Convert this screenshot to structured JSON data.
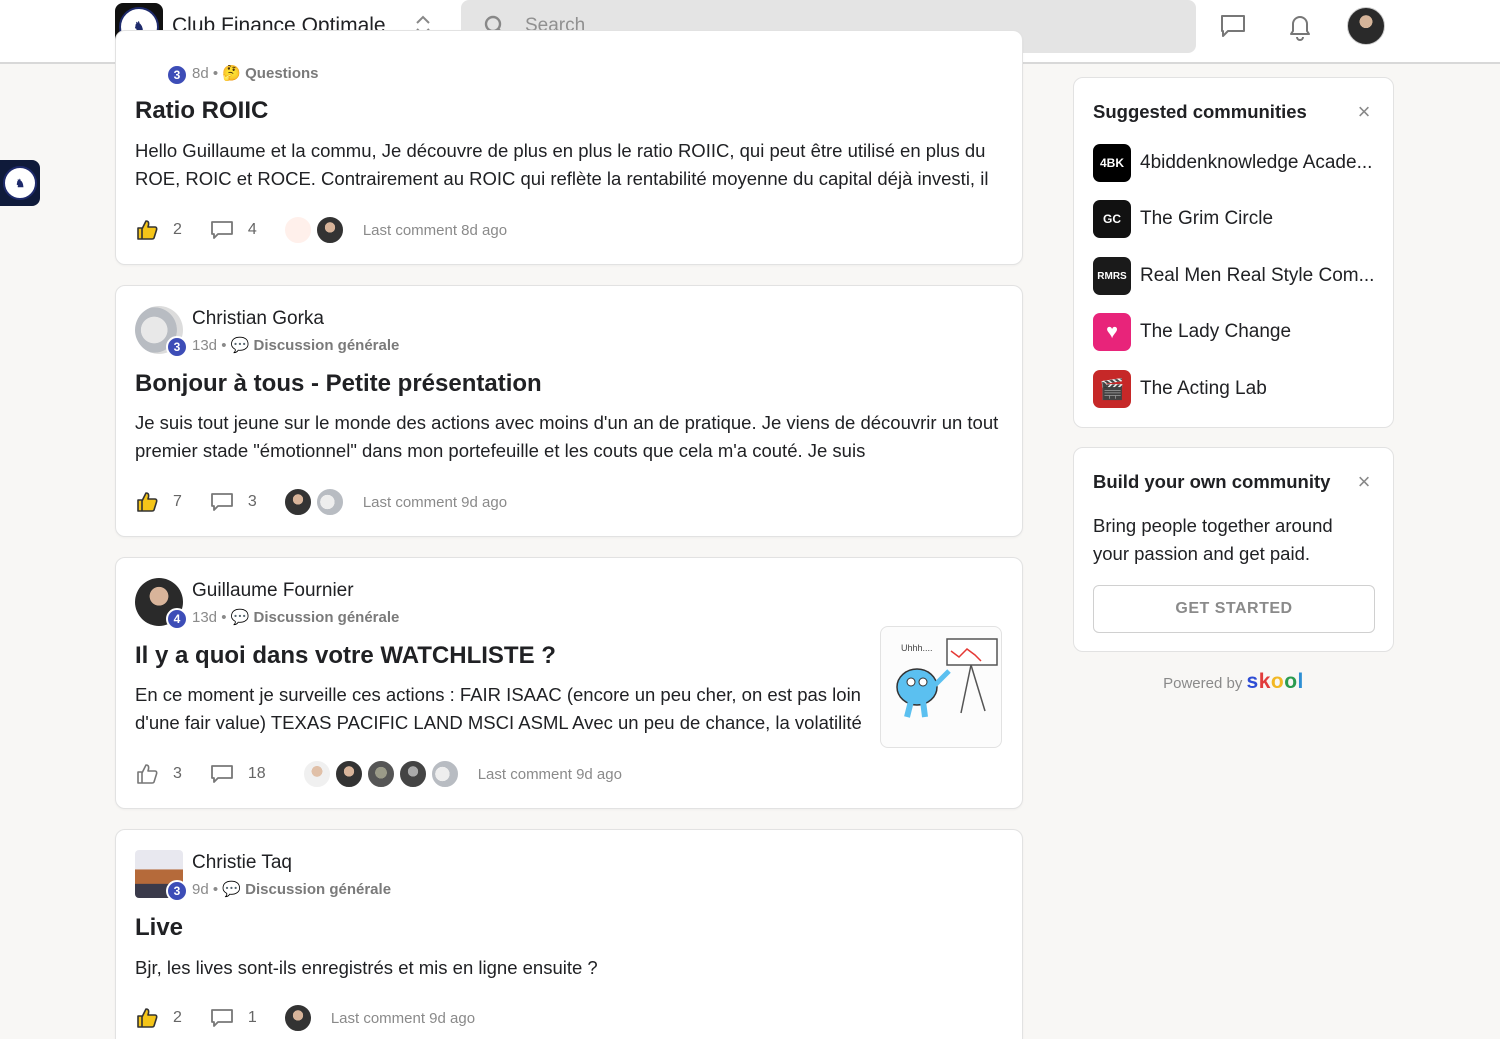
{
  "header": {
    "club_name": "Club Finance Optimale",
    "search_placeholder": "Search"
  },
  "posts": [
    {
      "level": "3",
      "time": "8d",
      "category_emoji": "🤔",
      "category": "Questions",
      "title": "Ratio ROIIC",
      "body": "Hello Guillaume et la commu, Je découvre de plus en plus le ratio ROIIC, qui peut être utilisé en plus du ROE, ROIC et ROCE. Contrairement au ROIC qui reflète la rentabilité moyenne du capital déjà investi, il",
      "likes": "2",
      "comments": "4",
      "last_comment": "Last comment 8d ago"
    },
    {
      "author": "Christian Gorka",
      "level": "3",
      "time": "13d",
      "category_emoji": "💬",
      "category": "Discussion générale",
      "title": "Bonjour à tous - Petite présentation",
      "body": "Je suis tout jeune sur le monde des actions avec moins d'un an de pratique. Je viens de découvrir un tout premier stade \"émotionnel\" dans mon portefeuille et les couts que cela m'a couté. Je suis",
      "likes": "7",
      "comments": "3",
      "last_comment": "Last comment 9d ago"
    },
    {
      "author": "Guillaume Fournier",
      "level": "4",
      "time": "13d",
      "category_emoji": "💬",
      "category": "Discussion générale",
      "title": "Il y a quoi dans votre WATCHLISTE ?",
      "body": "En ce moment je surveille ces actions : FAIR ISAAC (encore un peu cher, on est pas loin d'une fair value) TEXAS PACIFIC LAND MSCI ASML Avec un peu de chance, la volatilité",
      "likes": "3",
      "comments": "18",
      "last_comment": "Last comment 9d ago",
      "thumb_text": "Uhhh...."
    },
    {
      "author": "Christie Taq",
      "level": "3",
      "time": "9d",
      "category_emoji": "💬",
      "category": "Discussion générale",
      "title": "Live",
      "body": "Bjr, les lives sont-ils enregistrés et mis en ligne ensuite ?",
      "likes": "2",
      "comments": "1",
      "last_comment": "Last comment 9d ago"
    }
  ],
  "suggested": {
    "title": "Suggested communities",
    "items": [
      {
        "name": "4biddenknowledge Acade...",
        "icon_text": "4BK",
        "color": "#000000"
      },
      {
        "name": "The Grim Circle",
        "icon_text": "GC",
        "color": "#111111"
      },
      {
        "name": "Real Men Real Style Com...",
        "icon_text": "RMRS",
        "color": "#1a1a1a"
      },
      {
        "name": "The Lady Change",
        "icon_text": "♥",
        "color": "#e8247a"
      },
      {
        "name": "The Acting Lab",
        "icon_text": "🎬",
        "color": "#c62828"
      }
    ]
  },
  "build": {
    "title": "Build your own community",
    "text": "Bring people together around your passion and get paid.",
    "button": "GET STARTED"
  },
  "footer": {
    "powered_by": "Powered by",
    "brand": "skool"
  },
  "colors": {
    "level_badge": "#3d4db7",
    "background": "#f8f7f5"
  }
}
